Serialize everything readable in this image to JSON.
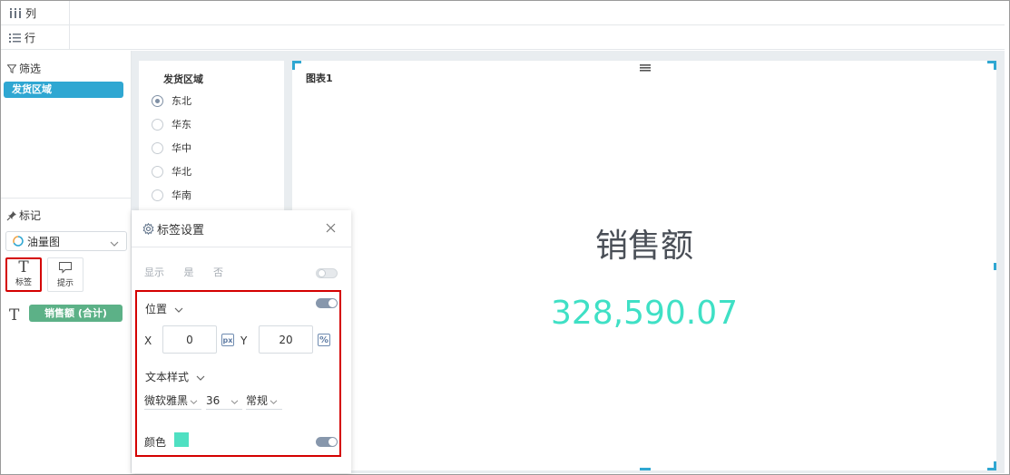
{
  "shelves": {
    "columns_label": "列",
    "rows_label": "行"
  },
  "filters": {
    "header": "筛选",
    "items": [
      "发货区域"
    ]
  },
  "marks": {
    "header": "标记",
    "chart_type": "油量图",
    "buttons": [
      {
        "glyph": "T",
        "label": "标签",
        "selected": true
      },
      {
        "label": "提示"
      }
    ],
    "field_glyph": "T",
    "field": "销售额 (合计)"
  },
  "region_filter": {
    "title": "发货区域",
    "options": [
      "东北",
      "华东",
      "华中",
      "华北",
      "华南"
    ],
    "selected": "东北"
  },
  "chart": {
    "title": "图表1",
    "kpi_label": "销售额",
    "kpi_value": "328,590.07",
    "value_color": "#3fe0c5"
  },
  "label_settings": {
    "title": "标签设置",
    "show": {
      "label": "显示",
      "yes": "是",
      "no": "否",
      "enabled": false
    },
    "position": {
      "label": "位置",
      "enabled": true
    },
    "x": {
      "label": "X",
      "value": "0",
      "unit": "px"
    },
    "y": {
      "label": "Y",
      "value": "20",
      "unit": "%"
    },
    "text_style": {
      "label": "文本样式",
      "font": "微软雅黑",
      "size": "36",
      "weight": "常规"
    },
    "color": {
      "label": "颜色",
      "swatch": "#4fe0c2",
      "enabled": true
    }
  },
  "colors": {
    "accent_blue": "#2fa7d2",
    "green_pill": "#5cb187",
    "highlight_red": "#d40000"
  }
}
